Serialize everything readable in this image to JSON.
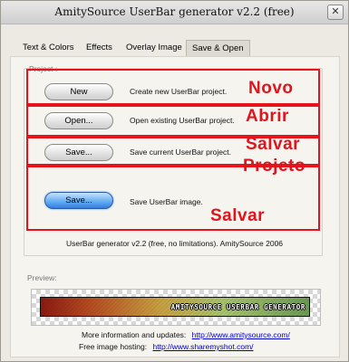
{
  "window": {
    "title": "AmitySource UserBar generator v2.2 (free)",
    "close_glyph": "✕"
  },
  "tabs": [
    {
      "label": "Text & Colors",
      "active": false
    },
    {
      "label": "Effects",
      "active": false
    },
    {
      "label": "Overlay Image",
      "active": false
    },
    {
      "label": "Save & Open",
      "active": true
    }
  ],
  "project_group": {
    "label": "Project :"
  },
  "rows": [
    {
      "button": "New",
      "description": "Create new UserBar project."
    },
    {
      "button": "Open...",
      "description": "Open existing UserBar project."
    },
    {
      "button": "Save...",
      "description": "Save current UserBar project."
    },
    {
      "button": "Save...",
      "description": "Save UserBar image."
    }
  ],
  "annotations": [
    {
      "text": "Novo"
    },
    {
      "text": "Abrir"
    },
    {
      "text": "Salvar"
    },
    {
      "text": "Projeto"
    },
    {
      "text": "Salvar"
    }
  ],
  "version_text": "UserBar generator v2.2 (free, no limitations). AmitySource 2006",
  "preview": {
    "label": "Preview:",
    "userbar_text": "AMITYSOURCE USERBAR GENERATOR"
  },
  "info": {
    "updates_label": "More information and updates:",
    "updates_url": "http://www.amitysource.com/",
    "hosting_label": "Free image hosting:",
    "hosting_url": "http://www.sharemyshot.com/"
  },
  "colors": {
    "annotation_red": "#e8121b",
    "link_blue": "#0000cc",
    "save_image_button": "#2f7fe0"
  }
}
